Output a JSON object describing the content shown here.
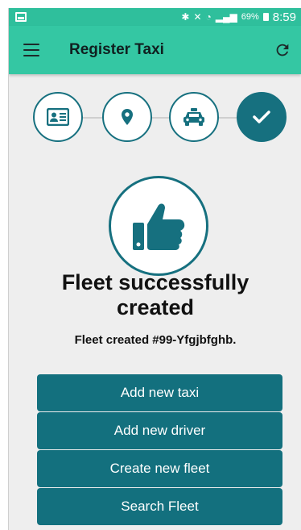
{
  "status_bar": {
    "battery": "69%",
    "time": "8:59"
  },
  "app_bar": {
    "title": "Register Taxi"
  },
  "stepper": {
    "steps": [
      {
        "icon": "id-card-icon",
        "state": "complete"
      },
      {
        "icon": "location-pin-icon",
        "state": "complete"
      },
      {
        "icon": "taxi-icon",
        "state": "complete"
      },
      {
        "icon": "checkmark-icon",
        "state": "current"
      }
    ]
  },
  "result": {
    "icon": "thumbs-up-icon",
    "title_line1": "Fleet successfully",
    "title_line2": "created",
    "message": "Fleet created #99-Yfgjbfghb."
  },
  "actions": {
    "add_taxi": "Add new taxi",
    "add_driver": "Add new driver",
    "create_fleet": "Create new fleet",
    "search_fleet": "Search Fleet"
  },
  "colors": {
    "app_bar": "#34c7a3",
    "status_bar": "#2fbf9c",
    "primary": "#13707e",
    "background": "#eeeeee"
  }
}
